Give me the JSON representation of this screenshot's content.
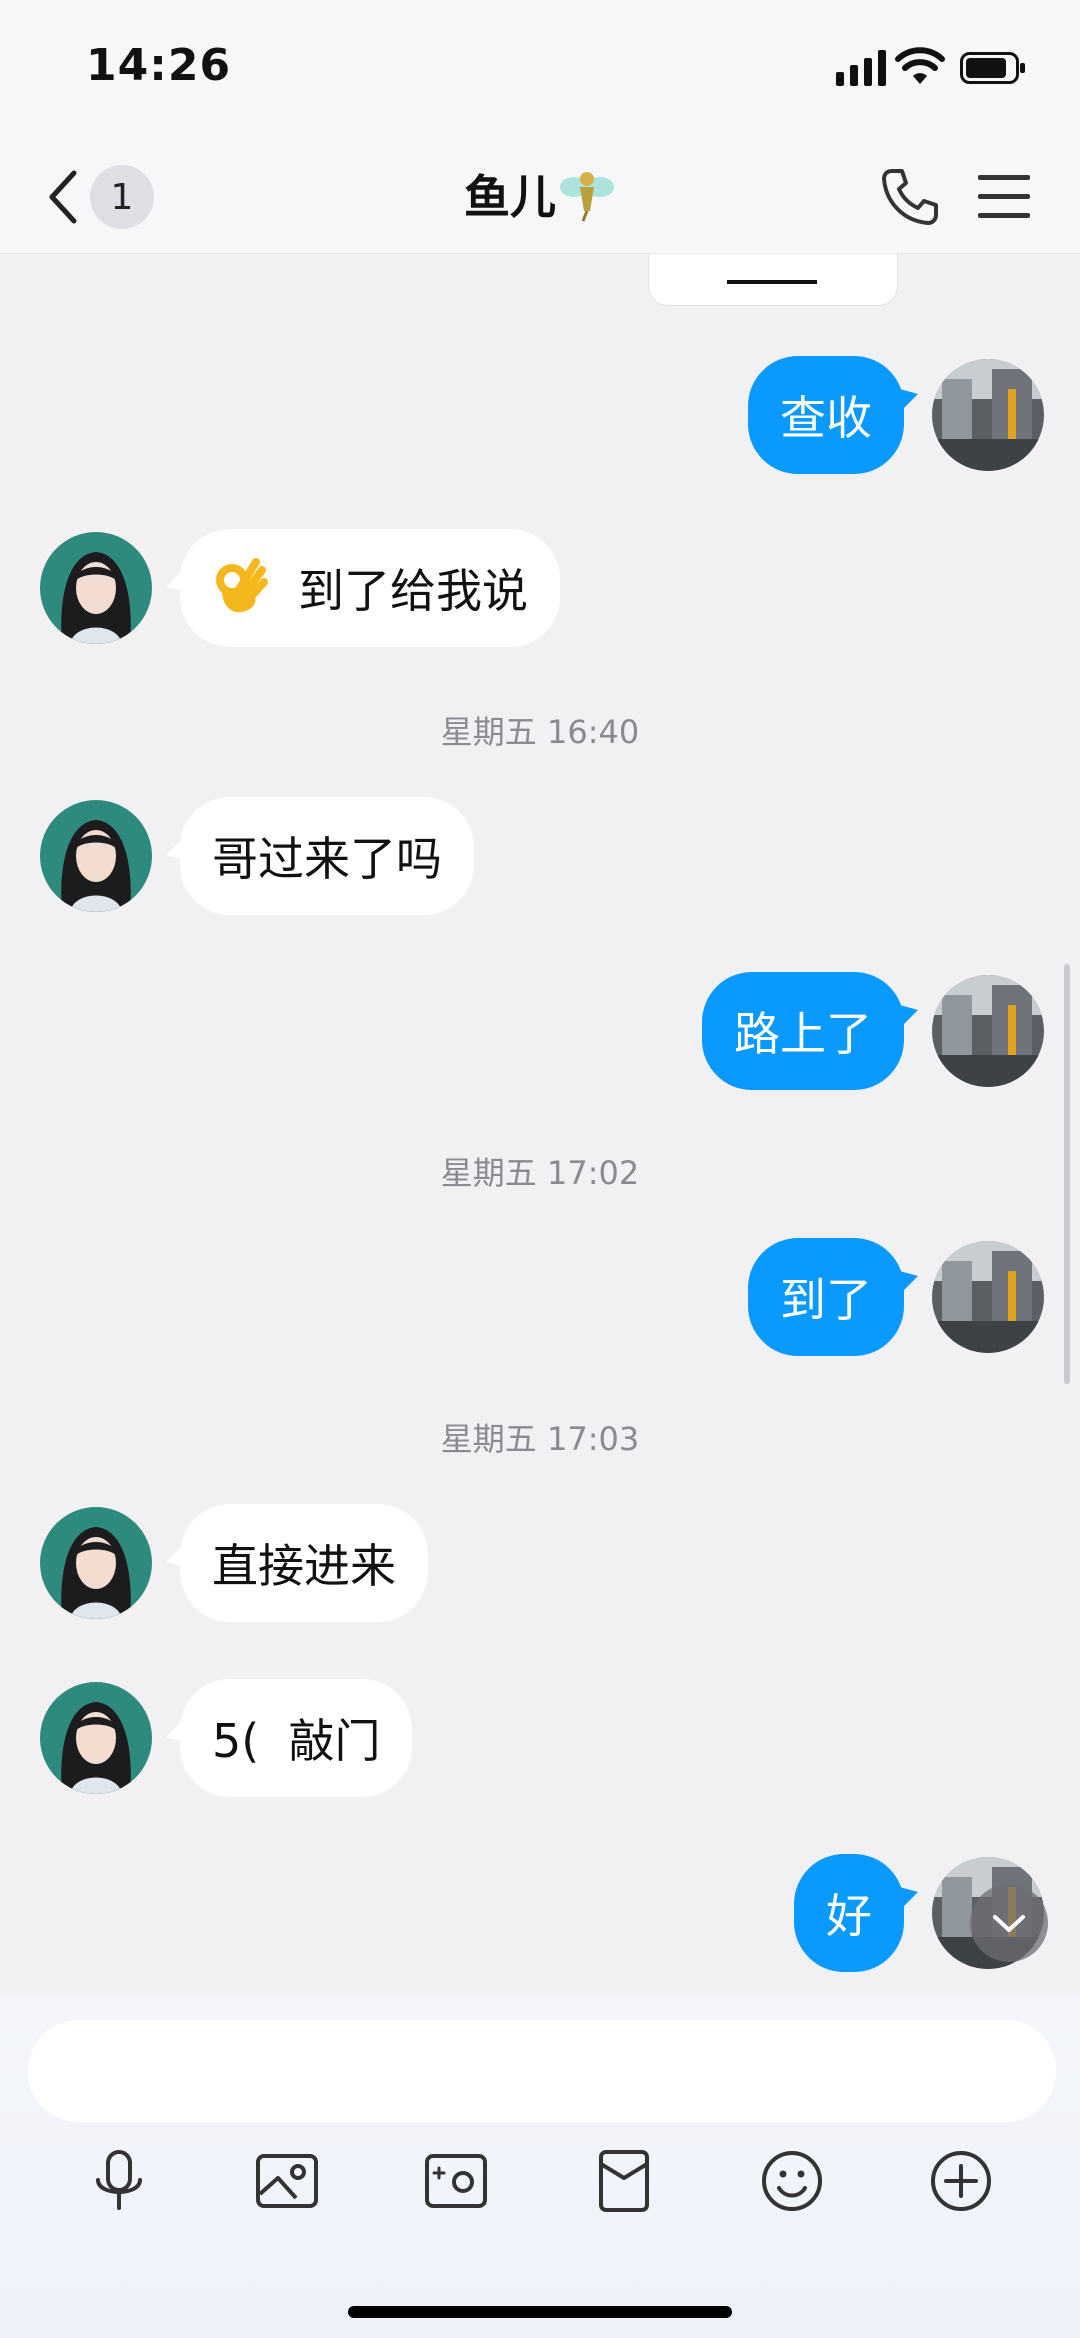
{
  "status_bar": {
    "time": "14:26"
  },
  "header": {
    "unread_count": "1",
    "title": "鱼儿"
  },
  "messages": [
    {
      "type": "out",
      "text": "查收"
    },
    {
      "type": "in",
      "text": "到了给我说",
      "emoji": "ok-hand"
    },
    {
      "type": "time",
      "text": "星期五 16:40"
    },
    {
      "type": "in",
      "text": "哥过来了吗"
    },
    {
      "type": "out",
      "text": "路上了"
    },
    {
      "type": "time",
      "text": "星期五 17:02"
    },
    {
      "type": "out",
      "text": "到了"
    },
    {
      "type": "time",
      "text": "星期五 17:03"
    },
    {
      "type": "in",
      "text": "直接进来"
    },
    {
      "type": "in",
      "text": "5(  敲门"
    },
    {
      "type": "out",
      "text": "好"
    }
  ],
  "input": {
    "placeholder": ""
  },
  "toolbar_icons": [
    "microphone-icon",
    "image-icon",
    "camera-icon",
    "red-packet-icon",
    "emoji-icon",
    "plus-icon"
  ],
  "colors": {
    "accent": "#0a99ff",
    "background": "#f1f1f3"
  }
}
